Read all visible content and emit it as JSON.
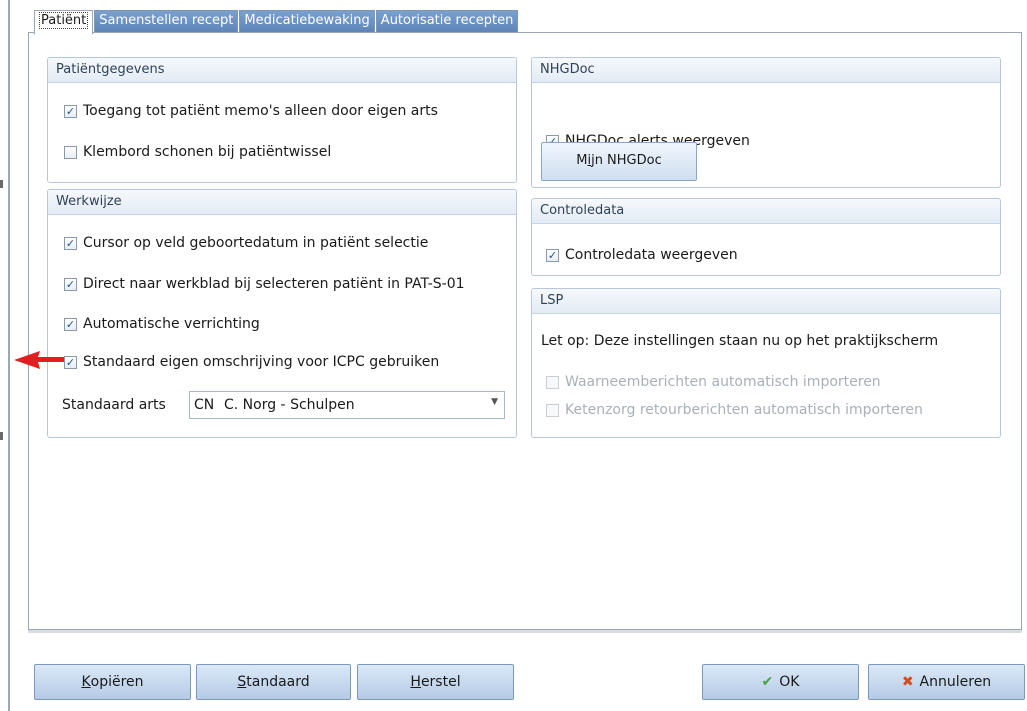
{
  "tabs": [
    {
      "label": "Patiënt"
    },
    {
      "label": "Samenstellen recept"
    },
    {
      "label": "Medicatiebewaking"
    },
    {
      "label": "Autorisatie recepten"
    }
  ],
  "patientgegevens": {
    "title": "Patiëntgegevens",
    "items": [
      {
        "label": "Toegang tot patiënt memo's alleen door eigen arts",
        "checked": true
      },
      {
        "label": "Klembord schonen bij patiëntwissel",
        "checked": false
      }
    ]
  },
  "werkwijze": {
    "title": "Werkwijze",
    "items": [
      {
        "label": "Cursor op veld geboortedatum in patiënt selectie",
        "checked": true
      },
      {
        "label": "Direct naar werkblad bij selecteren patiënt in PAT-S-01",
        "checked": true
      },
      {
        "label": "Automatische verrichting",
        "checked": true
      },
      {
        "label": "Standaard eigen omschrijving voor ICPC gebruiken",
        "checked": true
      }
    ],
    "standaard_arts_label": "Standaard arts",
    "standaard_arts_code": "CN",
    "standaard_arts_value": "C. Norg - Schulpen"
  },
  "nhgdoc": {
    "title": "NHGDoc",
    "alerts_label": "NHGDoc alerts weergeven",
    "alerts_checked": true,
    "button_prefix": "M",
    "button_mnemonic": "i",
    "button_suffix": "jn NHGDoc"
  },
  "controledata": {
    "title": "Controledata",
    "label": "Controledata weergeven",
    "checked": true
  },
  "lsp": {
    "title": "LSP",
    "note": "Let op: Deze instellingen staan nu op het praktijkscherm",
    "items": [
      {
        "label": "Waarneemberichten automatisch importeren",
        "checked": false,
        "disabled": true
      },
      {
        "label": "Ketenzorg retourberichten automatisch importeren",
        "checked": false,
        "disabled": true
      }
    ]
  },
  "footer": {
    "kopieren": {
      "mn": "K",
      "rest": "opiëren"
    },
    "standaard": {
      "mn": "S",
      "rest": "tandaard"
    },
    "herstel": {
      "mn": "H",
      "rest": "erstel"
    },
    "ok": "OK",
    "annuleren": "Annuleren"
  },
  "colors": {
    "accent": "#5d84b7",
    "check": "#1f4f9e",
    "arrow": "#e02020"
  }
}
